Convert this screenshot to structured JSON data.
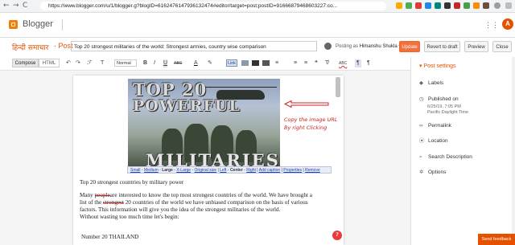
{
  "browser": {
    "back": "←",
    "forward": "→",
    "reload": "C",
    "url": "https://www.blogger.com/u/1/blogger.g?blogID=6162476147936132474#editor/target=post;postID=91666879468603227:co..."
  },
  "header": {
    "app_name": "Blogger",
    "avatar_letter": "A",
    "apps_glyph": "⋮⋮"
  },
  "post_header": {
    "blog_name": "हिन्दी समाचार",
    "separator": "·",
    "post_label": "Post",
    "title": "Top 20 strongest militaries of the world: Strongest armies, country wise comparison",
    "posting_as_prefix": "Posting as",
    "author": "Himanshu Shukla",
    "buttons": {
      "update": "Update",
      "revert": "Revert to draft",
      "preview": "Preview",
      "close": "Close"
    }
  },
  "toolbar": {
    "compose_tab": "Compose",
    "html_tab": "HTML",
    "undo": "↶",
    "redo": "↷",
    "font_glyph": "ℱ",
    "font_size_glyph": "T",
    "format": "Normal",
    "bold": "B",
    "italic": "I",
    "underline": "U",
    "strike": "ABC",
    "text_color": "A",
    "highlight": "✎",
    "link": "Link",
    "align": "≡",
    "numbered_list": "≡",
    "bullet_list": "≡",
    "quote": "❝",
    "clear_format": "T̸",
    "spellcheck": "ABC",
    "rtl": "¶",
    "ltr": "¶"
  },
  "image": {
    "line1": "TOP 20",
    "line2": "POWERFUL",
    "line3": "MILITARIES",
    "toolbar": {
      "small": "Small",
      "medium": "Medium",
      "large": "Large",
      "xlarge": "X-Large",
      "original": "Original size",
      "left": "Left",
      "center": "Center",
      "right": "Right",
      "add_caption": "Add caption",
      "properties": "Properties",
      "remove": "Remove"
    }
  },
  "annotation": {
    "line1": "Copy the image URL",
    "line2": "By right Clicking"
  },
  "editor": {
    "p1": "Top 20 strongest countries by military power",
    "p2_many": "Many",
    "p2_people": "people",
    "p2_rest": "are interested to know the top most strongest countries of the world. We have brought a",
    "p3_a": "list of the",
    "p3_strongest": "strongest",
    "p3_20": "20",
    "p3_rest": "countries of the world we have unbiased comparison on the basis of various",
    "p4": "factors. This information will give you the idea of the strongest militaries of the world.",
    "p5": "Without wasting too much time let's begin:",
    "heading": "Number 20 THAILAND",
    "grammarly_count": "7"
  },
  "sidebar": {
    "title": "Post settings",
    "items": [
      {
        "icon": "◆",
        "label": "Labels"
      },
      {
        "icon": "◷",
        "label": "Published on"
      },
      {
        "icon": "∞",
        "label": "Permalink"
      },
      {
        "icon": "⦿",
        "label": "Location"
      },
      {
        "icon": "⌕",
        "label": "Search Description"
      },
      {
        "icon": "✲",
        "label": "Options"
      }
    ],
    "published_date": "6/25/19, 7:05 PM",
    "published_tz": "Pacific Daylight Time"
  },
  "feedback": "Send feedback",
  "colors": {
    "brand_orange": "#e65100",
    "update_button": "#f2713a",
    "annotation_red": "#cc2020"
  }
}
